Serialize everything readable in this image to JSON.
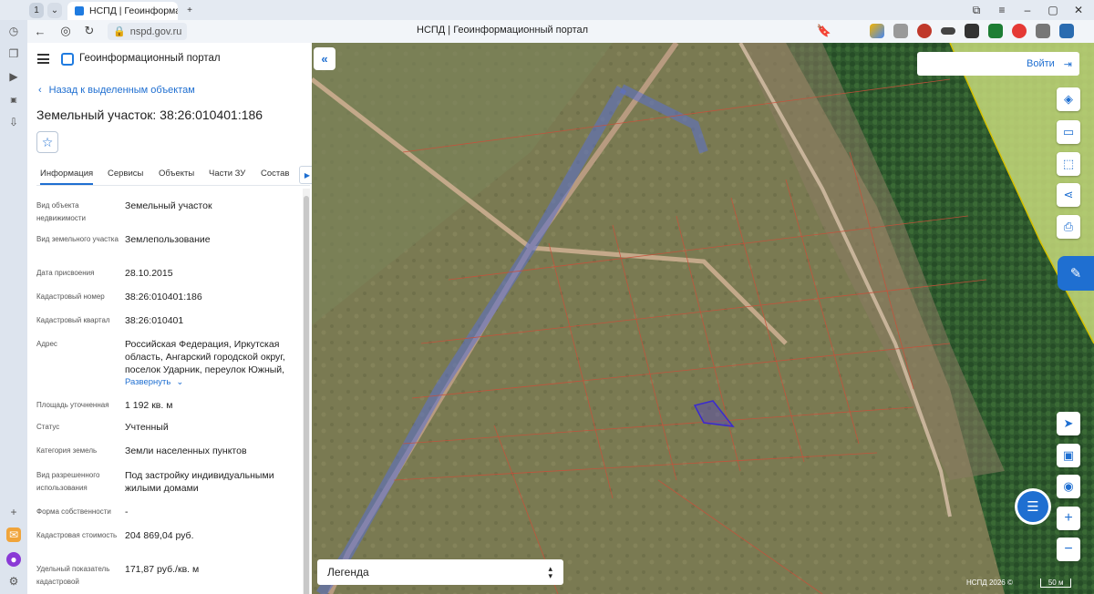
{
  "browser": {
    "tab_count": "1",
    "tab_title": "НСПД | Геоинформационный портал",
    "url": "nspd.gov.ru",
    "page_title": "НСПД | Геоинформационный портал"
  },
  "panel": {
    "portal_name": "Геоинформационный портал",
    "back_link": "Назад к выделенным объектам",
    "object_title": "Земельный участок: 38:26:010401:186",
    "tabs": [
      "Информация",
      "Сервисы",
      "Объекты",
      "Части ЗУ",
      "Состав"
    ],
    "fields": [
      {
        "label": "Вид объекта недвижимости",
        "value": "Земельный участок"
      },
      {
        "label": "Вид земельного участка",
        "value": "Землепользование"
      },
      {
        "label": "Дата присвоения",
        "value": "28.10.2015"
      },
      {
        "label": "Кадастровый номер",
        "value": "38:26:010401:186"
      },
      {
        "label": "Кадастровый квартал",
        "value": "38:26:010401"
      },
      {
        "label": "Адрес",
        "value": "Российская Федерация, Иркутская область, Ангарский городской округ, поселок Ударник, переулок Южный,"
      },
      {
        "label": "Площадь уточненная",
        "value": "1 192 кв. м"
      },
      {
        "label": "Статус",
        "value": "Учтенный"
      },
      {
        "label": "Категория земель",
        "value": "Земли населенных пунктов"
      },
      {
        "label": "Вид разрешенного использования",
        "value": "Под застройку индивидуальными жилыми домами"
      },
      {
        "label": "Форма собственности",
        "value": "-"
      },
      {
        "label": "Кадастровая стоимость",
        "value": "204 869,04 руб."
      },
      {
        "label": "Удельный показатель кадастровой",
        "value": "171,87 руб./кв. м"
      }
    ],
    "expand_link": "Развернуть"
  },
  "map": {
    "login": "Войти",
    "legend": "Легенда",
    "copyright": "НСПД 2026 ©",
    "scale": "50 м"
  }
}
